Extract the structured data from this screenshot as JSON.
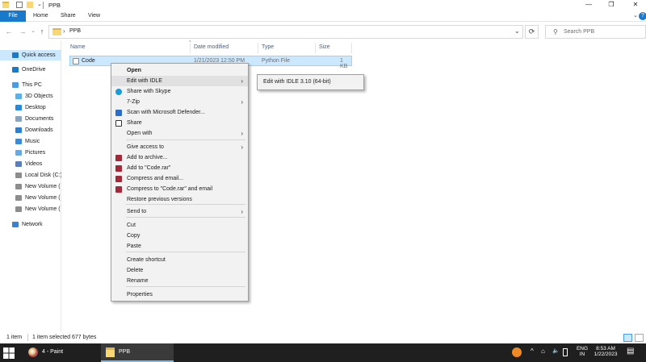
{
  "window": {
    "title": "PPB",
    "controls": {
      "minimize": "—",
      "maximize": "❐",
      "close": "✕"
    }
  },
  "ribbon": {
    "tabs": [
      "File",
      "Home",
      "Share",
      "View"
    ],
    "expand_glyph": "⌄",
    "help_glyph": "?"
  },
  "nav": {
    "back": "←",
    "forward": "→",
    "recent": "⌄",
    "up": "↑",
    "address": "PPB",
    "address_sep": "›",
    "dropdown": "⌄",
    "refresh": "⟳",
    "search_placeholder": "Search PPB",
    "search_glyph": "⚲"
  },
  "navpane": {
    "items": [
      {
        "label": "Quick access",
        "icon": "star-icon",
        "color": "#1979ca"
      },
      {
        "label": "OneDrive",
        "icon": "cloud-icon",
        "color": "#1979ca"
      },
      {
        "label": "This PC",
        "icon": "computer-icon",
        "color": "#4a9be0"
      },
      {
        "label": "3D Objects",
        "icon": "cube-icon",
        "color": "#5ab0e8"
      },
      {
        "label": "Desktop",
        "icon": "desktop-icon",
        "color": "#2b8ad8"
      },
      {
        "label": "Documents",
        "icon": "document-icon",
        "color": "#8aa4c0"
      },
      {
        "label": "Downloads",
        "icon": "download-icon",
        "color": "#2f7fd0"
      },
      {
        "label": "Music",
        "icon": "music-icon",
        "color": "#3d8ad6"
      },
      {
        "label": "Pictures",
        "icon": "pictures-icon",
        "color": "#6aa8e0"
      },
      {
        "label": "Videos",
        "icon": "video-icon",
        "color": "#5a7fb8"
      },
      {
        "label": "Local Disk (C:)",
        "icon": "drive-icon",
        "color": "#8d8d8d"
      },
      {
        "label": "New Volume (",
        "icon": "drive-icon",
        "color": "#8d8d8d"
      },
      {
        "label": "New Volume (",
        "icon": "drive-icon",
        "color": "#8d8d8d"
      },
      {
        "label": "New Volume (",
        "icon": "drive-icon",
        "color": "#8d8d8d"
      },
      {
        "label": "Network",
        "icon": "network-icon",
        "color": "#3a82cf"
      }
    ]
  },
  "columns": {
    "name": "Name",
    "date": "Date modified",
    "type": "Type",
    "size": "Size",
    "sort_glyph": "^"
  },
  "files": [
    {
      "name": "Code",
      "date": "1/21/2023 12:50 PM",
      "type": "Python File",
      "size": "1 KB"
    }
  ],
  "context_menu": {
    "items": [
      {
        "label": "Open",
        "bold": true
      },
      {
        "label": "Edit with IDLE",
        "submenu": true,
        "highlighted": true
      },
      {
        "label": "Share with Skype",
        "icon": "skype-icon"
      },
      {
        "label": "7-Zip",
        "submenu": true
      },
      {
        "label": "Scan with Microsoft Defender...",
        "icon": "defender-icon"
      },
      {
        "label": "Share",
        "icon": "share-icon"
      },
      {
        "label": "Open with",
        "submenu": true
      },
      {
        "label": "Give access to",
        "submenu": true
      },
      {
        "label": "Add to archive...",
        "icon": "winrar-icon"
      },
      {
        "label": "Add to \"Code.rar\"",
        "icon": "winrar-icon"
      },
      {
        "label": "Compress and email...",
        "icon": "winrar-icon"
      },
      {
        "label": "Compress to \"Code.rar\" and email",
        "icon": "winrar-icon"
      },
      {
        "label": "Restore previous versions"
      },
      {
        "label": "Send to",
        "submenu": true
      },
      {
        "label": "Cut"
      },
      {
        "label": "Copy"
      },
      {
        "label": "Paste"
      },
      {
        "label": "Create shortcut"
      },
      {
        "label": "Delete"
      },
      {
        "label": "Rename"
      },
      {
        "label": "Properties"
      }
    ],
    "arrow_glyph": "›",
    "submenu": {
      "label": "Edit with IDLE 3.10 (64-bit)"
    }
  },
  "status": {
    "count": "1 item",
    "selected": "1 item selected  677 bytes"
  },
  "taskbar": {
    "apps": [
      {
        "label": "4 - Paint"
      },
      {
        "label": "PPB"
      }
    ],
    "tray": {
      "chevron": "^",
      "network": "⌂",
      "volume": "🔈",
      "lang_top": "ENG",
      "lang_bottom": "IN",
      "time": "8:53 AM",
      "date": "1/22/2023",
      "notification": "▤"
    }
  },
  "colors": {
    "accent": "#1979ca",
    "selection": "#cce8ff",
    "folder": "#f8d775",
    "taskbar": "#1f1f1f"
  }
}
